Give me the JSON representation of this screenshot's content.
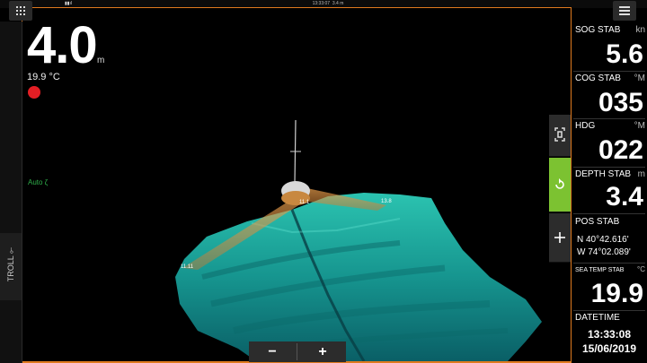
{
  "status": {
    "time": "13:33:07",
    "depth_short": "3.4 m"
  },
  "depth": {
    "value": "4.0",
    "unit": "m",
    "temperature": "19.9 °C"
  },
  "mode": {
    "troll_label": "TROLL",
    "gauge_label": "Auto ζ"
  },
  "range_labels": {
    "left": "11.11",
    "center": "11.1",
    "right": "13.8"
  },
  "zoom": {
    "out_label": "−",
    "in_label": "+"
  },
  "panel": {
    "sog": {
      "label": "SOG STAB",
      "unit": "kn",
      "value": "5.6"
    },
    "cog": {
      "label": "COG STAB",
      "unit": "°M",
      "value": "035"
    },
    "hdg": {
      "label": "HDG",
      "unit": "°M",
      "value": "022"
    },
    "depth": {
      "label": "DEPTH STAB",
      "unit": "m",
      "value": "3.4"
    },
    "pos": {
      "label": "POS STAB",
      "lat": "N  40°42.616'",
      "lon": "W  74°02.089'"
    },
    "seatemp": {
      "label": "SEA TEMP STAB",
      "unit": "°C",
      "value": "19.9"
    },
    "datetime": {
      "label": "DATETIME",
      "time": "13:33:08",
      "date": "15/06/2019"
    }
  },
  "colors": {
    "accent": "#e07a1e",
    "seabed": "#1fb8a8",
    "active_tool": "#7cc231",
    "record": "#e31e24"
  }
}
